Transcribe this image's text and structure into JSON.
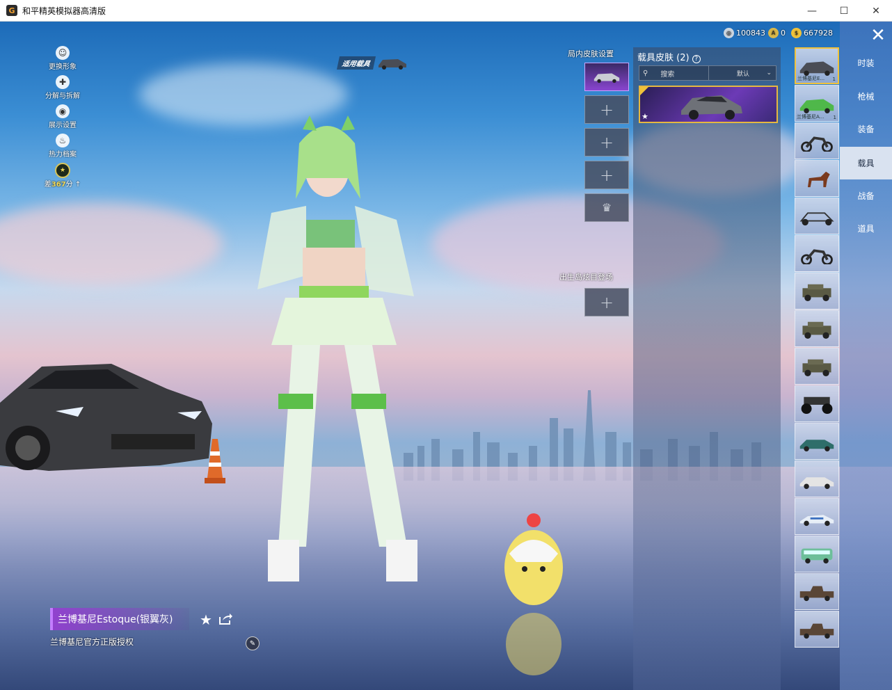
{
  "window": {
    "title": "和平精英模拟器高清版",
    "minimize_glyph": "—",
    "maximize_glyph": "☐",
    "close_glyph": "✕"
  },
  "currency": {
    "silver": "100843",
    "medal": "0",
    "gold": "667928"
  },
  "left_menu": {
    "items": [
      "更换形象",
      "分解与拆解",
      "展示设置",
      "热力档案"
    ],
    "heat_prefix": "差",
    "heat_value": "367",
    "heat_suffix": "分"
  },
  "apply_tag": "适用载具",
  "inmatch_settings": {
    "title": "局内皮肤设置",
    "add_glyph": "+",
    "crown_glyph": "♛"
  },
  "spawn_section": {
    "title": "出生岛炫目登场",
    "add_glyph": "+"
  },
  "skin_panel": {
    "title": "载具皮肤 (2)",
    "help_glyph": "?",
    "search_label": "搜索",
    "sort_label": "默认",
    "selected_skin": "兰博基尼Estoque(银翼灰)"
  },
  "vehicle_list": [
    {
      "name": "兰博基尼E...",
      "count": "1",
      "kind": "car-dark",
      "selected": true
    },
    {
      "name": "兰博基尼A...",
      "count": "1",
      "kind": "car-green"
    },
    {
      "name": "",
      "count": "",
      "kind": "motorbike"
    },
    {
      "name": "",
      "count": "",
      "kind": "horse"
    },
    {
      "name": "",
      "count": "",
      "kind": "buggy"
    },
    {
      "name": "",
      "count": "",
      "kind": "motorbike"
    },
    {
      "name": "",
      "count": "",
      "kind": "jeep"
    },
    {
      "name": "",
      "count": "",
      "kind": "jeep"
    },
    {
      "name": "",
      "count": "",
      "kind": "jeep"
    },
    {
      "name": "",
      "count": "",
      "kind": "monster-truck"
    },
    {
      "name": "",
      "count": "",
      "kind": "sedan-teal"
    },
    {
      "name": "",
      "count": "",
      "kind": "sedan-white"
    },
    {
      "name": "",
      "count": "",
      "kind": "sports-blue"
    },
    {
      "name": "",
      "count": "",
      "kind": "van"
    },
    {
      "name": "",
      "count": "",
      "kind": "pickup"
    },
    {
      "name": "",
      "count": "",
      "kind": "pickup"
    }
  ],
  "categories": [
    "时装",
    "枪械",
    "装备",
    "载具",
    "战备",
    "道具"
  ],
  "active_category": "载具",
  "vehicle_info": {
    "name": "兰博基尼Estoque(银翼灰)",
    "license": "兰博基尼官方正版授权"
  },
  "colors": {
    "accent_purple": "#8a45d0",
    "accent_gold": "#f0c23a",
    "tab_active_bg": "#d9e2f0"
  }
}
